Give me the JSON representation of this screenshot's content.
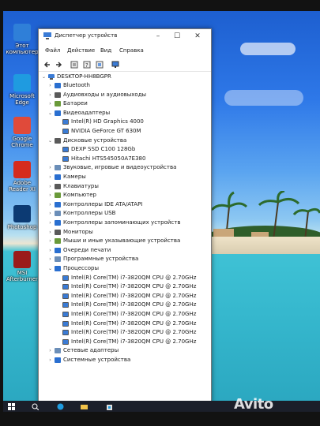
{
  "desktop": {
    "icons": [
      {
        "label": "Этот компьютер",
        "icon": "computer-icon",
        "color": "#2f7fd8"
      },
      {
        "label": "Microsoft Edge",
        "icon": "edge-icon",
        "color": "#1f9be0"
      },
      {
        "label": "Google Chrome",
        "icon": "chrome-icon",
        "color": "#e04a3a"
      },
      {
        "label": "Adobe Reader XI",
        "icon": "adobe-reader-icon",
        "color": "#d52b1e"
      },
      {
        "label": "Photoshop",
        "icon": "photoshop-icon",
        "color": "#0c3a73"
      },
      {
        "label": "MSI Afterburner",
        "icon": "msi-afterburner-icon",
        "color": "#9a1b1b"
      }
    ]
  },
  "window": {
    "title": "Диспетчер устройств",
    "menu": [
      "Файл",
      "Действие",
      "Вид",
      "Справка"
    ],
    "toolbar_icons": [
      "back-arrow-icon",
      "forward-arrow-icon",
      "properties-icon",
      "help-icon",
      "refresh-icon",
      "monitor-icon"
    ],
    "root": "DESKTOP-HH8BGPR",
    "tree": [
      {
        "label": "Bluetooth",
        "level": 1,
        "expanded": false
      },
      {
        "label": "Аудиовходы и аудиовыходы",
        "level": 1,
        "expanded": false
      },
      {
        "label": "Батареи",
        "level": 1,
        "expanded": false
      },
      {
        "label": "Видеоадаптеры",
        "level": 1,
        "expanded": true
      },
      {
        "label": "Intel(R) HD Graphics 4000",
        "level": 2
      },
      {
        "label": "NVIDIA GeForce GT 630M",
        "level": 2
      },
      {
        "label": "Дисковые устройства",
        "level": 1,
        "expanded": true
      },
      {
        "label": "DEXP SSD C100 128Gb",
        "level": 2
      },
      {
        "label": "Hitachi HTS545050A7E380",
        "level": 2
      },
      {
        "label": "Звуковые, игровые и видеоустройства",
        "level": 1,
        "expanded": false
      },
      {
        "label": "Камеры",
        "level": 1,
        "expanded": false
      },
      {
        "label": "Клавиатуры",
        "level": 1,
        "expanded": false
      },
      {
        "label": "Компьютер",
        "level": 1,
        "expanded": false
      },
      {
        "label": "Контроллеры IDE ATA/ATAPI",
        "level": 1,
        "expanded": false
      },
      {
        "label": "Контроллеры USB",
        "level": 1,
        "expanded": false
      },
      {
        "label": "Контроллеры запоминающих устройств",
        "level": 1,
        "expanded": false
      },
      {
        "label": "Мониторы",
        "level": 1,
        "expanded": false
      },
      {
        "label": "Мыши и иные указывающие устройства",
        "level": 1,
        "expanded": false
      },
      {
        "label": "Очереди печати",
        "level": 1,
        "expanded": false
      },
      {
        "label": "Программные устройства",
        "level": 1,
        "expanded": false
      },
      {
        "label": "Процессоры",
        "level": 1,
        "expanded": true
      },
      {
        "label": "Intel(R) Core(TM) i7-3820QM CPU @ 2.70GHz",
        "level": 2
      },
      {
        "label": "Intel(R) Core(TM) i7-3820QM CPU @ 2.70GHz",
        "level": 2
      },
      {
        "label": "Intel(R) Core(TM) i7-3820QM CPU @ 2.70GHz",
        "level": 2
      },
      {
        "label": "Intel(R) Core(TM) i7-3820QM CPU @ 2.70GHz",
        "level": 2
      },
      {
        "label": "Intel(R) Core(TM) i7-3820QM CPU @ 2.70GHz",
        "level": 2
      },
      {
        "label": "Intel(R) Core(TM) i7-3820QM CPU @ 2.70GHz",
        "level": 2
      },
      {
        "label": "Intel(R) Core(TM) i7-3820QM CPU @ 2.70GHz",
        "level": 2
      },
      {
        "label": "Intel(R) Core(TM) i7-3820QM CPU @ 2.70GHz",
        "level": 2
      },
      {
        "label": "Сетевые адаптеры",
        "level": 1,
        "expanded": false
      },
      {
        "label": "Системные устройства",
        "level": 1,
        "expanded": false
      }
    ]
  },
  "taskbar": {
    "icons": [
      "windows-start-icon",
      "search-icon",
      "edge-icon",
      "file-explorer-icon",
      "store-icon"
    ]
  },
  "watermark": "Avito"
}
